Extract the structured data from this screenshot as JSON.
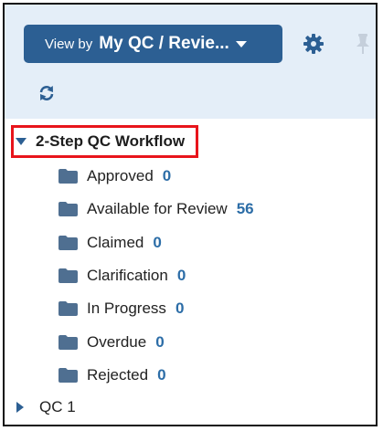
{
  "toolbar": {
    "view_by_prefix": "View by",
    "view_by_value": "My QC / Revie...",
    "icons": [
      "chevron-down-icon",
      "gear-icon",
      "pin-icon",
      "refresh-icon"
    ],
    "colors": {
      "button": "#2c5f93",
      "header_bg": "#e4eef8",
      "count": "#2c6da7",
      "highlight": "#e8141b"
    }
  },
  "tree": {
    "root": {
      "label": "2-Step QC Workflow",
      "expanded": true
    },
    "folders": [
      {
        "label": "Approved",
        "count": "0"
      },
      {
        "label": "Available for Review",
        "count": "56"
      },
      {
        "label": "Claimed",
        "count": "0"
      },
      {
        "label": "Clarification",
        "count": "0"
      },
      {
        "label": "In Progress",
        "count": "0"
      },
      {
        "label": "Overdue",
        "count": "0"
      },
      {
        "label": "Rejected",
        "count": "0"
      }
    ],
    "second_root": {
      "label": "QC 1",
      "expanded": false
    }
  }
}
